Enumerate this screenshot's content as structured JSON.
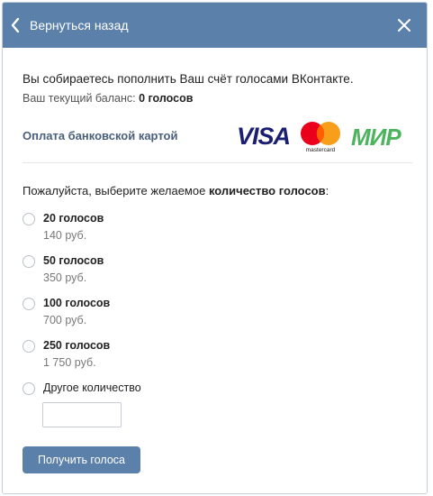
{
  "header": {
    "back_label": "Вернуться назад",
    "background_color": "#5b80aa"
  },
  "intro": {
    "text": "Вы собираетесь пополнить Ваш счёт голосами ВКонтакте.",
    "balance_label": "Ваш текущий баланс:",
    "balance_value": "0 голосов"
  },
  "payment": {
    "label": "Оплата банковской картой",
    "logos": {
      "visa_text": "VISA",
      "mastercard_text": "mastercard",
      "mir_text": "МИР"
    },
    "colors": {
      "visa": "#1a1f71",
      "mc_red": "#eb001b",
      "mc_orange": "#f79e1b",
      "mir_green": "#4db45e"
    }
  },
  "form": {
    "prompt_prefix": "Пожалуйста, выберите желаемое",
    "prompt_bold": "количество голосов",
    "prompt_suffix": ":",
    "options": [
      {
        "title": "20 голосов",
        "price": "140 руб."
      },
      {
        "title": "50 голосов",
        "price": "350 руб."
      },
      {
        "title": "100 голосов",
        "price": "700 руб."
      },
      {
        "title": "250 голосов",
        "price": "1 750 руб."
      }
    ],
    "custom_option_label": "Другое количество",
    "custom_input_value": "",
    "submit_label": "Получить голоса"
  }
}
